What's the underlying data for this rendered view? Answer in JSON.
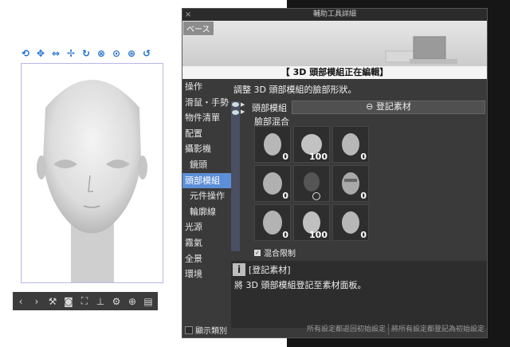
{
  "window": {
    "title": "輔助工具詳細",
    "close_icon": "×"
  },
  "preview": {
    "base_label": "ベース",
    "banner": "【 3D 頭部模組正在編輯】"
  },
  "nav": {
    "items": [
      {
        "label": "操作",
        "level": 0
      },
      {
        "label": "滑鼠・手勢",
        "level": 0
      },
      {
        "label": "物件清單",
        "level": 0
      },
      {
        "label": "配置",
        "level": 0
      },
      {
        "label": "攝影機",
        "level": 0
      },
      {
        "label": "鏡頭",
        "level": 1
      },
      {
        "label": "頭部模組",
        "level": 0,
        "active": true
      },
      {
        "label": "元件操作",
        "level": 1
      },
      {
        "label": "輪廓線",
        "level": 1
      },
      {
        "label": "光源",
        "level": 0
      },
      {
        "label": "霧氣",
        "level": 0
      },
      {
        "label": "全景",
        "level": 0
      },
      {
        "label": "環境",
        "level": 0
      }
    ],
    "show_category": "顯示類別"
  },
  "content": {
    "description": "調整 3D 頭部模組的臉部形狀。",
    "head_model_label": "頭部模組",
    "register_button": "登記素材",
    "face_blend_label": "臉部混合",
    "blend_values": [
      "0",
      "100",
      "0",
      "0",
      "",
      "0",
      "0",
      "100",
      "0"
    ],
    "mix_limit": "混合限制",
    "info_title": "[登記素材]",
    "info_body": "將 3D 頭部模組登記至素材面板。",
    "reset_all": "所有設定都返回初始設定",
    "register_all_initial": "將所有設定都登記為初始設定"
  },
  "colors": {
    "active_nav": "#5c8fd7",
    "canvas_icon": "#1e6fd0"
  }
}
